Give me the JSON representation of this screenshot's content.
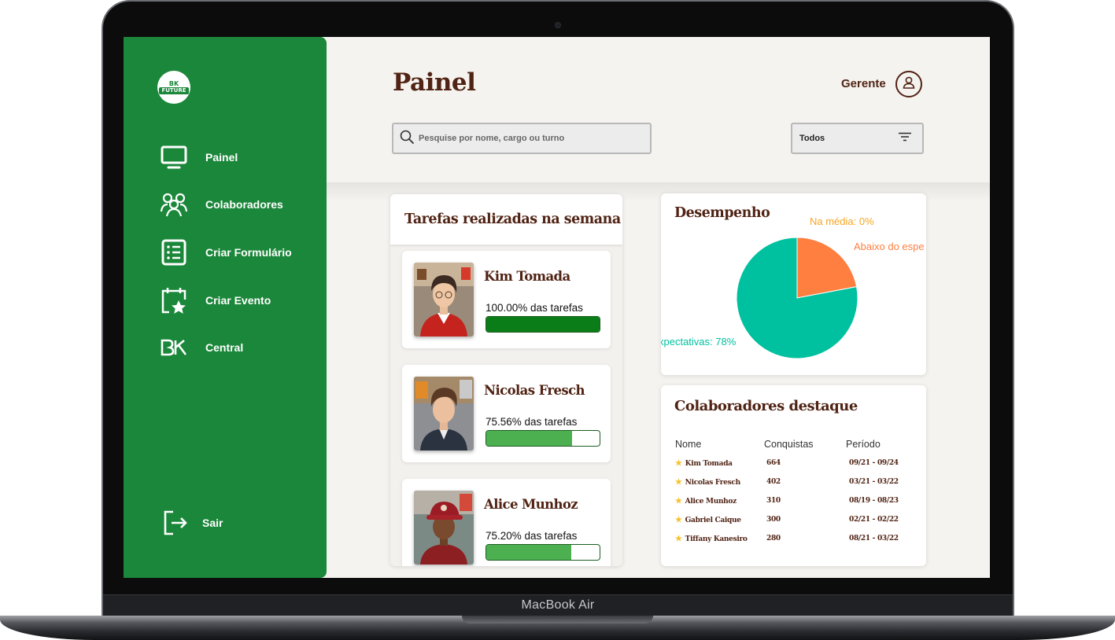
{
  "device": {
    "label": "MacBook Air"
  },
  "sidebar": {
    "logo": {
      "top": "BK",
      "bottom": "FUTURE"
    },
    "items": [
      {
        "label": "Painel",
        "icon": "monitor-icon"
      },
      {
        "label": "Colaboradores",
        "icon": "users-icon"
      },
      {
        "label": "Criar Formulário",
        "icon": "form-icon"
      },
      {
        "label": "Criar Evento",
        "icon": "calendar-star-icon"
      },
      {
        "label": "Central",
        "icon": "bk-icon"
      }
    ],
    "logout": {
      "label": "Sair",
      "icon": "logout-icon"
    }
  },
  "header": {
    "title": "Painel",
    "user_role": "Gerente",
    "search": {
      "placeholder": "Pesquise por nome, cargo ou turno",
      "value": ""
    },
    "filter": {
      "selected": "Todos"
    }
  },
  "tasks": {
    "title": "Tarefas realizadas na semana",
    "items": [
      {
        "name": "Kim Tomada",
        "percent_text": "100.00% das tarefas",
        "progress": 100.0
      },
      {
        "name": "Nicolas Fresch",
        "percent_text": "75.56% das tarefas",
        "progress": 75.56
      },
      {
        "name": "Alice Munhoz",
        "percent_text": "75.20% das tarefas",
        "progress": 75.2
      }
    ]
  },
  "performance": {
    "title": "Desempenho",
    "label_above": "Abaixo do espe",
    "label_average": "Na média: 0%",
    "label_expect": "xpectativas: 78%"
  },
  "chart_data": {
    "type": "pie",
    "title": "Desempenho",
    "slices": [
      {
        "label": "Abaixo do esperado",
        "value": 22,
        "color": "#ff7f41"
      },
      {
        "label": "Na média",
        "value": 0,
        "color": "#f5a623"
      },
      {
        "label": "Acima das expectativas",
        "value": 78,
        "color": "#00c19f"
      }
    ]
  },
  "highlights": {
    "title": "Colaboradores destaque",
    "columns": [
      "Nome",
      "Conquistas",
      "Período"
    ],
    "rows": [
      {
        "name": "Kim Tomada",
        "achievements": "664",
        "period": "09/21 - 09/24"
      },
      {
        "name": "Nicolas Fresch",
        "achievements": "402",
        "period": "03/21 - 03/22"
      },
      {
        "name": "Alice Munhoz",
        "achievements": "310",
        "period": "08/19 - 08/23"
      },
      {
        "name": "Gabriel Caique",
        "achievements": "300",
        "period": "02/21 - 02/22"
      },
      {
        "name": "Tiffany Kanesiro",
        "achievements": "280",
        "period": "08/21 - 03/22"
      }
    ]
  },
  "colors": {
    "brand_green": "#1b873a",
    "brand_brown": "#502314",
    "background": "#f5f3ef"
  }
}
